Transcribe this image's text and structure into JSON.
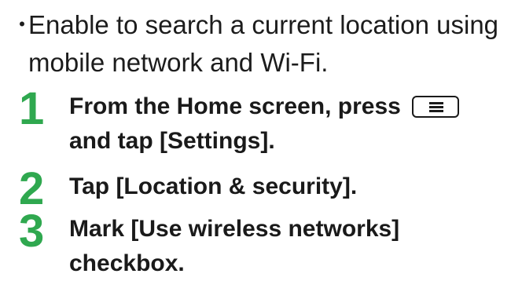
{
  "intro": {
    "bullet": "・",
    "text": "Enable to search a current location using mobile network and Wi-Fi."
  },
  "steps": [
    {
      "number": "1",
      "text_before_icon": "From the Home screen, press",
      "icon": "menu-key-icon",
      "text_after_icon": "and tap [Settings]."
    },
    {
      "number": "2",
      "text": "Tap [Location & security]."
    },
    {
      "number": "3",
      "text": "Mark [Use wireless networks] checkbox."
    }
  ],
  "colors": {
    "step_number": "#2fa84f",
    "text": "#1a1a1a"
  }
}
